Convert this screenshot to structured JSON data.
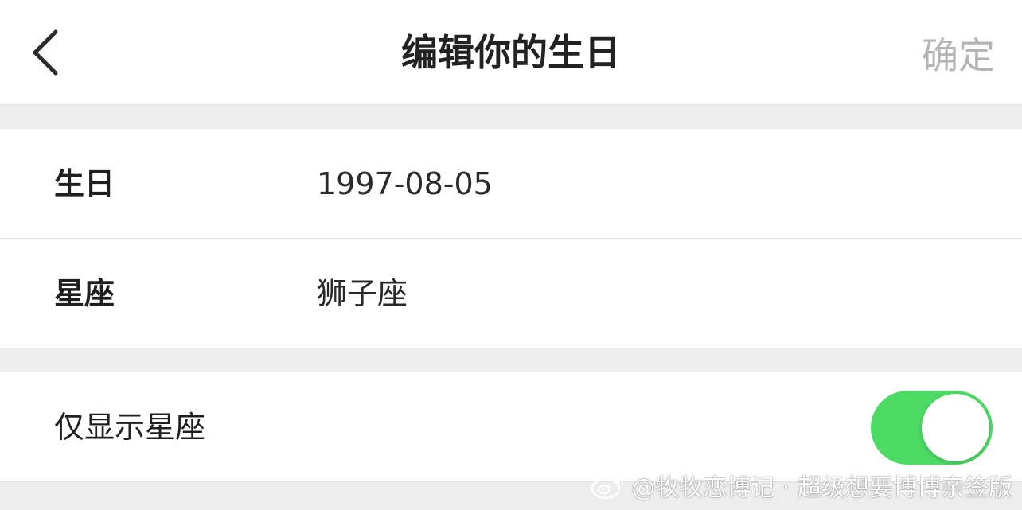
{
  "header": {
    "title": "编辑你的生日",
    "confirm_label": "确定",
    "back_icon": "chevron-left-icon"
  },
  "birthday_group": {
    "birthday": {
      "label": "生日",
      "value": "1997-08-05"
    },
    "zodiac": {
      "label": "星座",
      "value": "狮子座"
    }
  },
  "options_group": {
    "show_zodiac_only": {
      "label": "仅显示星座",
      "enabled": true
    }
  },
  "watermark": {
    "icon": "weibo-logo-icon",
    "text": "@牧牧恋博记 · 超级想要博博亲签版"
  },
  "colors": {
    "toggle_on": "#4cd964",
    "confirm_disabled": "#b4b4b4",
    "background": "#ededed"
  }
}
